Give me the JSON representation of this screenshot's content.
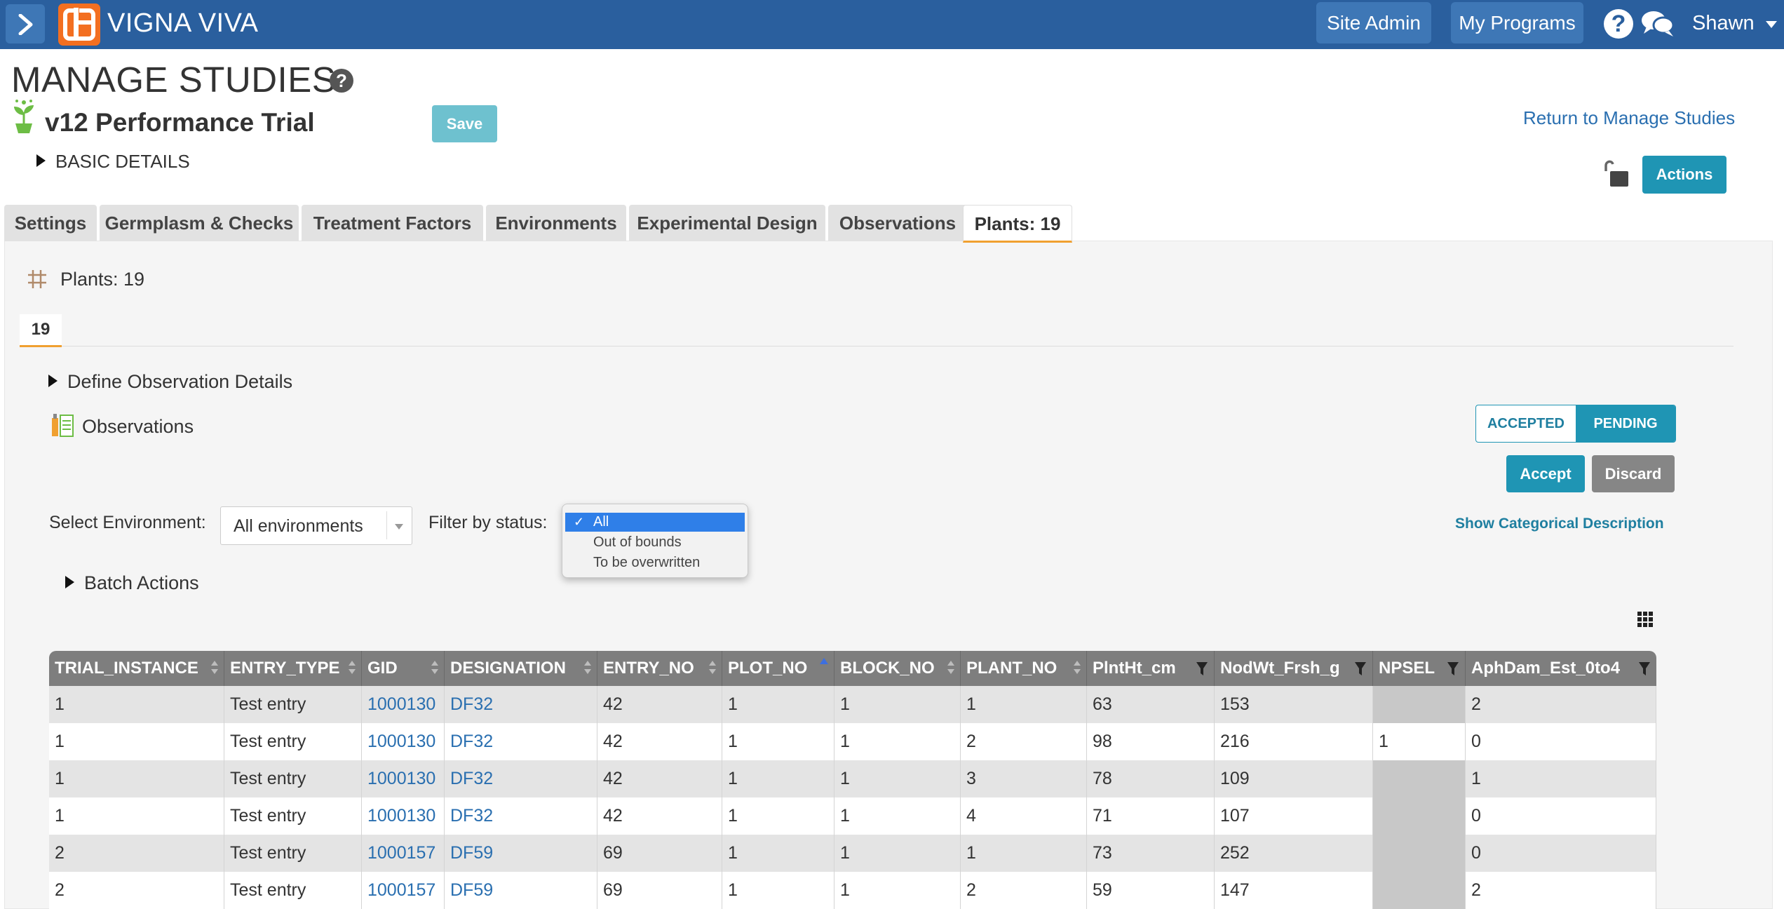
{
  "topbar": {
    "app_name": "VIGNA VIVA",
    "site_admin": "Site Admin",
    "my_programs": "My Programs",
    "help": "?",
    "user": "Shawn"
  },
  "header": {
    "title": "MANAGE STUDIES",
    "help": "?",
    "study_name": "v12 Performance Trial",
    "save": "Save",
    "return_link": "Return to Manage Studies",
    "actions": "Actions",
    "basic_details": "BASIC DETAILS"
  },
  "tabs": [
    {
      "label": "Settings"
    },
    {
      "label": "Germplasm & Checks"
    },
    {
      "label": "Treatment Factors"
    },
    {
      "label": "Environments"
    },
    {
      "label": "Experimental Design"
    },
    {
      "label": "Observations"
    },
    {
      "label": "Plants: 19"
    }
  ],
  "plants": {
    "heading": "Plants: 19",
    "subtab": "19",
    "define_observation_details": "Define Observation Details",
    "observations_title": "Observations",
    "toggle": {
      "accepted": "ACCEPTED",
      "pending": "PENDING"
    },
    "accept": "Accept",
    "discard": "Discard",
    "show_categorical": "Show Categorical Description",
    "select_environment_label": "Select Environment:",
    "environment_value": "All environments",
    "filter_label": "Filter by status:",
    "status_options": [
      {
        "label": "All",
        "selected": true
      },
      {
        "label": "Out of bounds",
        "selected": false
      },
      {
        "label": "To be overwritten",
        "selected": false
      }
    ],
    "batch_actions": "Batch Actions"
  },
  "table": {
    "columns": [
      "TRIAL_INSTANCE",
      "ENTRY_TYPE",
      "GID",
      "DESIGNATION",
      "ENTRY_NO",
      "PLOT_NO",
      "BLOCK_NO",
      "PLANT_NO",
      "PlntHt_cm",
      "NodWt_Frsh_g",
      "NPSEL",
      "AphDam_Est_0to4"
    ],
    "rows": [
      [
        "1",
        "Test entry",
        "1000130",
        "DF32",
        "42",
        "1",
        "1",
        "1",
        "63",
        "153",
        "",
        "2"
      ],
      [
        "1",
        "Test entry",
        "1000130",
        "DF32",
        "42",
        "1",
        "1",
        "2",
        "98",
        "216",
        "1",
        "0"
      ],
      [
        "1",
        "Test entry",
        "1000130",
        "DF32",
        "42",
        "1",
        "1",
        "3",
        "78",
        "109",
        "",
        "1"
      ],
      [
        "1",
        "Test entry",
        "1000130",
        "DF32",
        "42",
        "1",
        "1",
        "4",
        "71",
        "107",
        "",
        "0"
      ],
      [
        "2",
        "Test entry",
        "1000157",
        "DF59",
        "69",
        "1",
        "1",
        "1",
        "73",
        "252",
        "",
        "0"
      ],
      [
        "2",
        "Test entry",
        "1000157",
        "DF59",
        "69",
        "1",
        "1",
        "2",
        "59",
        "147",
        "",
        "2"
      ]
    ]
  },
  "colors": {
    "topbar": "#2a5f9e",
    "accent": "#1f95b4",
    "brand_orange": "#f36f21",
    "tab_active_underline": "#f0a030",
    "link": "#2a6fb0"
  }
}
